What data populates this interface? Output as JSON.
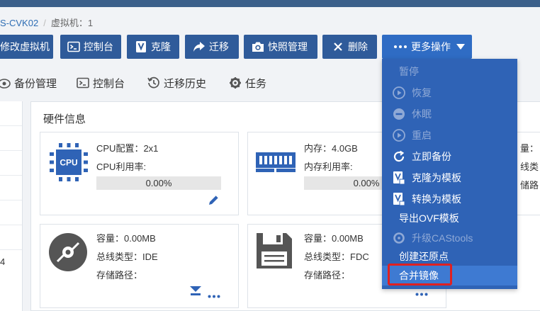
{
  "breadcrumb": {
    "host": "S-CVK02",
    "separator": "/",
    "vm_label": "虚拟机：1"
  },
  "toolbar": {
    "modify_vm": "修改虚拟机",
    "console": "控制台",
    "clone": "克隆",
    "migrate": "迁移",
    "snapshot": "快照管理",
    "delete": "删除",
    "more": "更多操作"
  },
  "tabs": {
    "backup": "备份管理",
    "console": "控制台",
    "migrate_history": "迁移历史",
    "tasks": "任务"
  },
  "left_panel": {
    "row_value": "4"
  },
  "hardware": {
    "title": "硬件信息",
    "cpu": {
      "config_label": "CPU配置：2x1",
      "usage_label": "CPU利用率:",
      "usage_value": "0.00%",
      "usage_fraction": 0.0,
      "icon_text": "CPU"
    },
    "memory": {
      "size_label": "内存：4.0GB",
      "usage_label": "内存利用率:",
      "usage_value": "0.00%",
      "usage_fraction": 0.0
    },
    "disk_partial": {
      "label1": "量：",
      "label2": "线类",
      "label3": "储路"
    },
    "cdrom": {
      "capacity": "容量：0.00MB",
      "bus": "总线类型：IDE",
      "path": "存储路径："
    },
    "floppy": {
      "capacity": "容量：0.00MB",
      "bus": "总线类型：FDC",
      "path": "存储路径："
    }
  },
  "more_menu": {
    "items": [
      {
        "label": "暂停",
        "disabled": true
      },
      {
        "label": "恢复",
        "disabled": true
      },
      {
        "label": "休眠",
        "disabled": true
      },
      {
        "label": "重启",
        "disabled": true
      },
      {
        "label": "立即备份",
        "disabled": false
      },
      {
        "label": "克隆为模板",
        "disabled": false
      },
      {
        "label": "转换为模板",
        "disabled": false
      },
      {
        "label": "导出OVF模板",
        "disabled": false
      },
      {
        "label": "升级CAStools",
        "disabled": true
      },
      {
        "label": "创建还原点",
        "disabled": false
      },
      {
        "label": "合并镜像",
        "disabled": false,
        "highlighted": true
      }
    ]
  },
  "colors": {
    "toolbar_button": "#2f5b9a",
    "menu_bg": "#2f63b6",
    "highlight_box": "#e02020"
  }
}
